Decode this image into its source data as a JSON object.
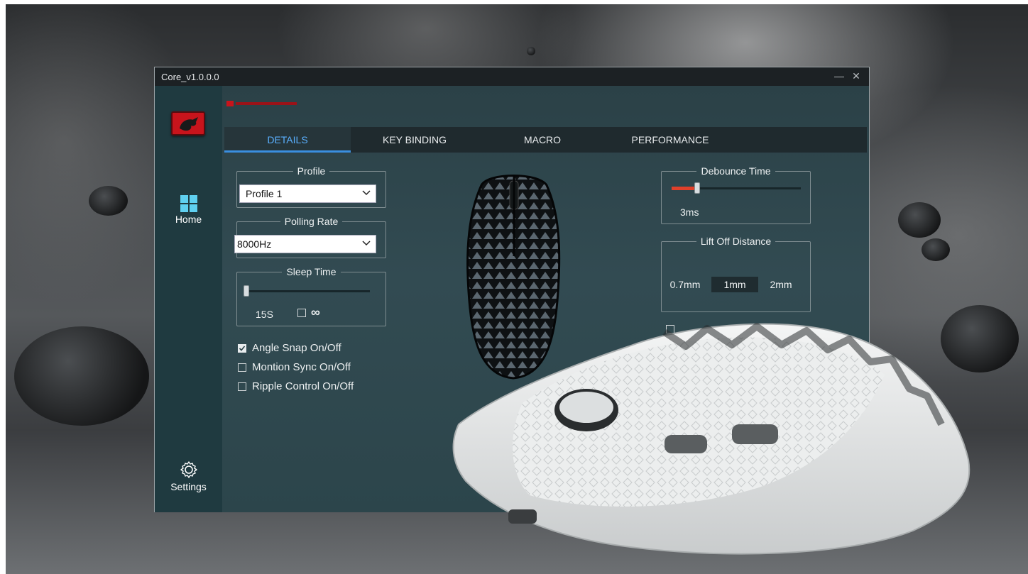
{
  "window": {
    "title": "Core_v1.0.0.0",
    "minimize_symbol": "—",
    "close_symbol": "✕"
  },
  "sidebar": {
    "items": [
      {
        "label": "Home",
        "icon": "home-grid-icon"
      },
      {
        "label": "Settings",
        "icon": "gear-icon"
      }
    ]
  },
  "tabs": [
    {
      "label": "DETAILS",
      "active": true
    },
    {
      "label": "KEY BINDING",
      "active": false
    },
    {
      "label": "MACRO",
      "active": false
    },
    {
      "label": "PERFORMANCE",
      "active": false
    }
  ],
  "details": {
    "profile": {
      "legend": "Profile",
      "selected": "Profile 1"
    },
    "polling_rate": {
      "legend": "Polling Rate",
      "selected": "8000Hz"
    },
    "sleep_time": {
      "legend": "Sleep Time",
      "value_label": "15S",
      "infinity_symbol": "∞",
      "infinity_checked": false,
      "slider_fraction": 0.0
    },
    "checkboxes": [
      {
        "label": "Angle Snap On/Off",
        "checked": true
      },
      {
        "label": "Montion Sync On/Off",
        "checked": false
      },
      {
        "label": "Ripple Control On/Off",
        "checked": false
      }
    ],
    "debounce": {
      "legend": "Debounce Time",
      "value_label": "3ms",
      "slider_fraction": 0.2
    },
    "lift_off": {
      "legend": "Lift Off Distance",
      "options": [
        "0.7mm",
        "1mm",
        "2mm"
      ],
      "selected": "1mm"
    }
  },
  "colors": {
    "accent_blue": "#3a8fe0",
    "slider_red": "#e0402a",
    "brand_red": "#c8141c"
  }
}
